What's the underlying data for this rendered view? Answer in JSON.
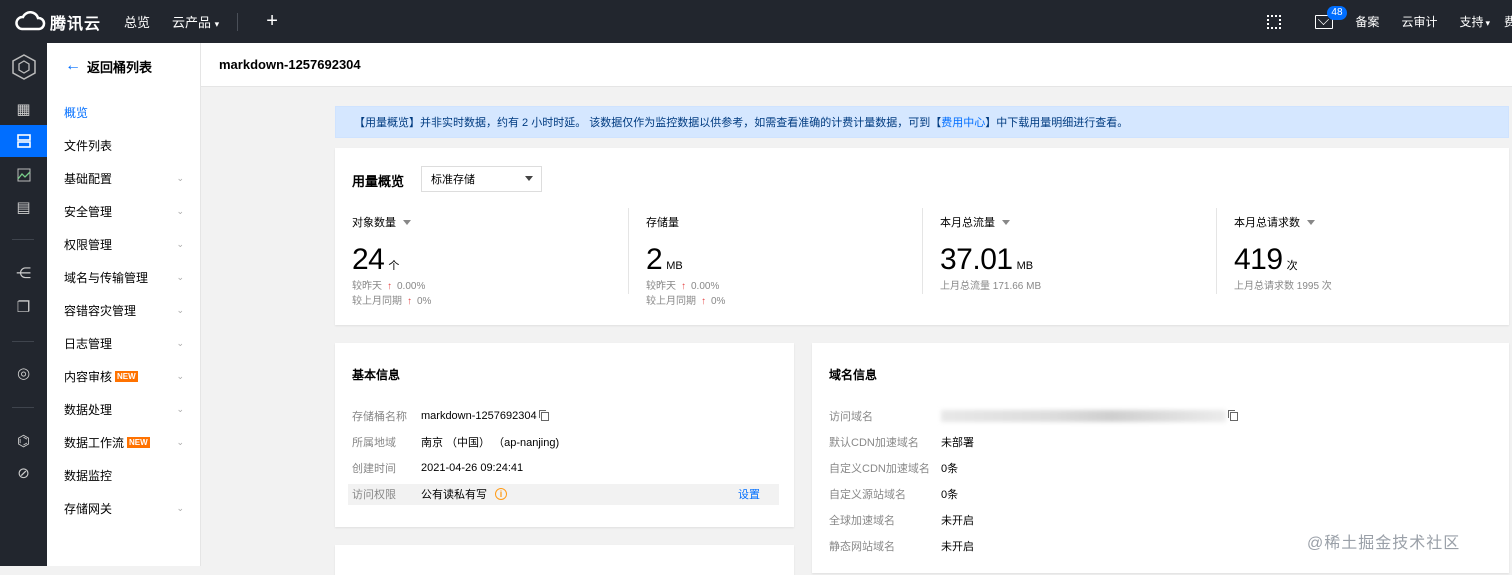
{
  "topbar": {
    "logo_text": "腾讯云",
    "nav_overview": "总览",
    "nav_products": "云产品",
    "plus": "+",
    "mail_count": "48",
    "record": "备案",
    "audit": "云审计",
    "support": "支持",
    "chevron": "⌄"
  },
  "sidenav": {
    "back_label": "返回桶列表",
    "items": [
      {
        "label": "概览",
        "active": true
      },
      {
        "label": "文件列表"
      },
      {
        "label": "基础配置"
      },
      {
        "label": "安全管理"
      },
      {
        "label": "权限管理"
      },
      {
        "label": "域名与传输管理"
      },
      {
        "label": "容错容灾管理"
      },
      {
        "label": "日志管理"
      },
      {
        "label": "内容审核",
        "badge": "NEW"
      },
      {
        "label": "数据处理"
      },
      {
        "label": "数据工作流",
        "badge": "NEW"
      },
      {
        "label": "数据监控"
      },
      {
        "label": "存储网关"
      }
    ]
  },
  "page": {
    "title": "markdown-1257692304"
  },
  "notice": {
    "text_a": "【用量概览】并非实时数据，约有 2 小时时延。 该数据仅作为监控数据以供参考，如需查看准确的计费计量数据，可到【",
    "link": "费用中心",
    "text_b": "】中下载用量明细进行查看。"
  },
  "usage": {
    "title": "用量概览",
    "select_value": "标准存储",
    "metrics": [
      {
        "label": "对象数量",
        "value": "24",
        "unit": "个",
        "day_label": "较昨天",
        "day_pct": "0.00%",
        "month_label": "较上月同期",
        "month_pct": "0%"
      },
      {
        "label": "存储量",
        "value": "2",
        "unit": "MB",
        "day_label": "较昨天",
        "day_pct": "0.00%",
        "month_label": "较上月同期",
        "month_pct": "0%"
      },
      {
        "label": "本月总流量",
        "value": "37.01",
        "unit": "MB",
        "prev": "上月总流量 171.66 MB"
      },
      {
        "label": "本月总请求数",
        "value": "419",
        "unit": "次",
        "prev": "上月总请求数 1995 次"
      }
    ]
  },
  "basic": {
    "title": "基本信息",
    "bucket_key": "存储桶名称",
    "bucket_val": "markdown-1257692304",
    "region_key": "所属地域",
    "region_val": "南京 （中国） （ap-nanjing)",
    "created_key": "创建时间",
    "created_val": "2021-04-26 09:24:41",
    "access_key": "访问权限",
    "access_val": "公有读私有写",
    "access_action": "设置"
  },
  "domain": {
    "title": "域名信息",
    "rows": [
      {
        "k": "访问域名",
        "v": ""
      },
      {
        "k": "默认CDN加速域名",
        "v": "未部署"
      },
      {
        "k": "自定义CDN加速域名",
        "v": "0条"
      },
      {
        "k": "自定义源站域名",
        "v": "0条"
      },
      {
        "k": "全球加速域名",
        "v": "未开启"
      },
      {
        "k": "静态网站域名",
        "v": "未开启"
      }
    ]
  },
  "watermark": "@稀土掘金技术社区",
  "colors": {
    "accent": "#006eff",
    "topbar": "#22262e",
    "warn": "#ff7200",
    "up": "#e54545"
  }
}
